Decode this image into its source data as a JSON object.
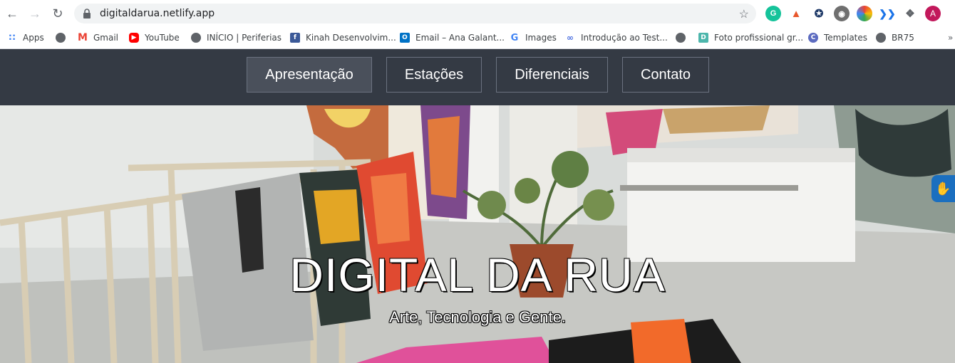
{
  "browser": {
    "url": "digitaldarua.netlify.app",
    "profile_initial": "A"
  },
  "bookmarks": [
    {
      "label": "Apps"
    },
    {
      "label": "Gmail"
    },
    {
      "label": "YouTube"
    },
    {
      "label": "INÍCIO | Periferias"
    },
    {
      "label": "Kinah Desenvolvim..."
    },
    {
      "label": "Email – Ana Galant..."
    },
    {
      "label": "Images"
    },
    {
      "label": "Introdução ao Test..."
    },
    {
      "label": "Foto profissional gr..."
    },
    {
      "label": "Templates"
    },
    {
      "label": "BR75"
    }
  ],
  "nav": {
    "items": [
      {
        "label": "Apresentação",
        "active": true
      },
      {
        "label": "Estações"
      },
      {
        "label": "Diferenciais"
      },
      {
        "label": "Contato"
      }
    ]
  },
  "hero": {
    "title": "DIGITAL DA RUA",
    "subtitle": "Arte, Tecnologia e Gente."
  },
  "colors": {
    "nav_bg": "#343a44",
    "accessibility": "#1b6fbf"
  }
}
